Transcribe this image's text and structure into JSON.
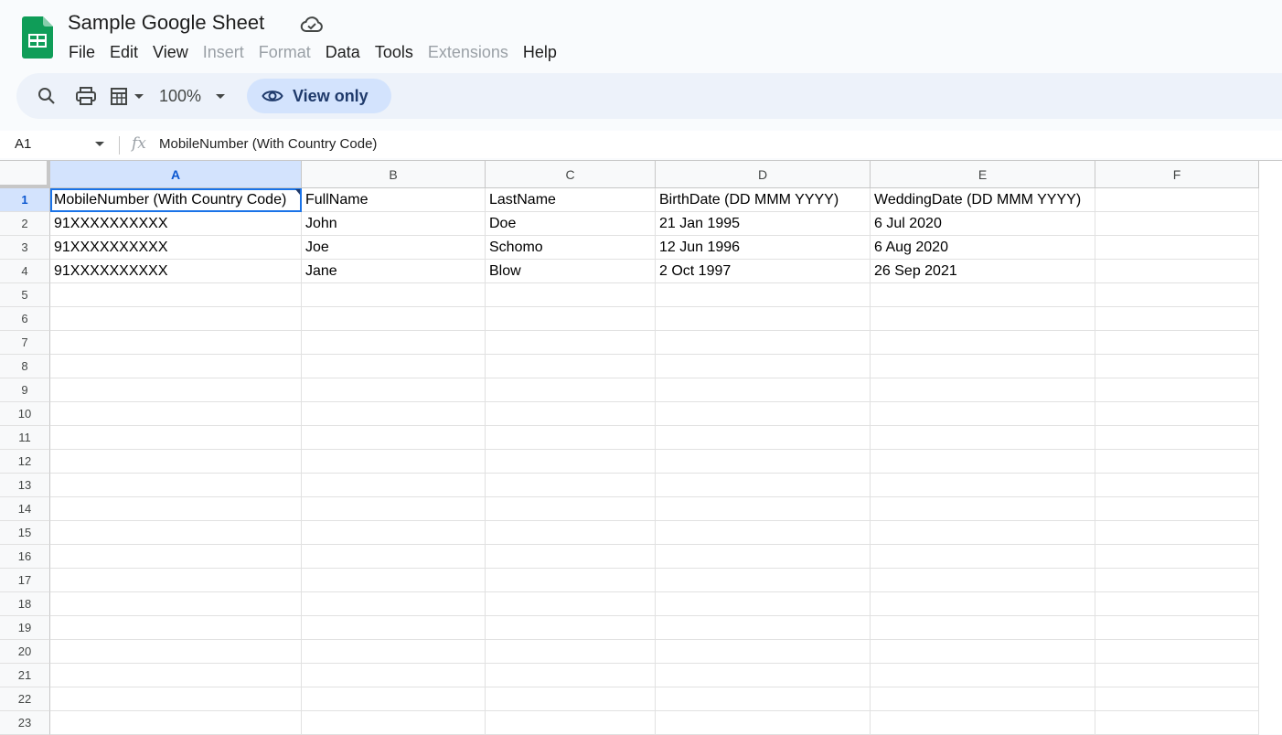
{
  "app": {
    "title": "Sample Google Sheet"
  },
  "menu": [
    {
      "label": "File",
      "disabled": false
    },
    {
      "label": "Edit",
      "disabled": false
    },
    {
      "label": "View",
      "disabled": false
    },
    {
      "label": "Insert",
      "disabled": true
    },
    {
      "label": "Format",
      "disabled": true
    },
    {
      "label": "Data",
      "disabled": false
    },
    {
      "label": "Tools",
      "disabled": false
    },
    {
      "label": "Extensions",
      "disabled": true
    },
    {
      "label": "Help",
      "disabled": false
    }
  ],
  "toolbar": {
    "zoom": "100%",
    "view_only_label": "View only",
    "icons": [
      "search-icon",
      "print-icon",
      "format-icon",
      "eye-icon"
    ]
  },
  "formula_bar": {
    "cell_ref": "A1",
    "fx_label": "fx",
    "value": "MobileNumber (With Country Code)"
  },
  "sheet": {
    "columns": [
      "A",
      "B",
      "C",
      "D",
      "E",
      "F"
    ],
    "active_column": "A",
    "active_row": "1",
    "rows": [
      {
        "num": "1",
        "cells": [
          "MobileNumber (With Country Code)",
          "FullName",
          "LastName",
          "BirthDate (DD MMM YYYY)",
          "WeddingDate (DD MMM YYYY)",
          ""
        ]
      },
      {
        "num": "2",
        "cells": [
          "91XXXXXXXXXX",
          "John",
          "Doe",
          "21 Jan 1995",
          "6 Jul 2020",
          ""
        ]
      },
      {
        "num": "3",
        "cells": [
          "91XXXXXXXXXX",
          "Joe",
          "Schomo",
          "12 Jun 1996",
          "6 Aug 2020",
          ""
        ]
      },
      {
        "num": "4",
        "cells": [
          "91XXXXXXXXXX",
          "Jane",
          "Blow",
          "2 Oct 1997",
          "26 Sep 2021",
          ""
        ]
      },
      {
        "num": "5",
        "cells": [
          "",
          "",
          "",
          "",
          "",
          ""
        ]
      },
      {
        "num": "6",
        "cells": [
          "",
          "",
          "",
          "",
          "",
          ""
        ]
      },
      {
        "num": "7",
        "cells": [
          "",
          "",
          "",
          "",
          "",
          ""
        ]
      },
      {
        "num": "8",
        "cells": [
          "",
          "",
          "",
          "",
          "",
          ""
        ]
      },
      {
        "num": "9",
        "cells": [
          "",
          "",
          "",
          "",
          "",
          ""
        ]
      },
      {
        "num": "10",
        "cells": [
          "",
          "",
          "",
          "",
          "",
          ""
        ]
      },
      {
        "num": "11",
        "cells": [
          "",
          "",
          "",
          "",
          "",
          ""
        ]
      },
      {
        "num": "12",
        "cells": [
          "",
          "",
          "",
          "",
          "",
          ""
        ]
      },
      {
        "num": "13",
        "cells": [
          "",
          "",
          "",
          "",
          "",
          ""
        ]
      },
      {
        "num": "14",
        "cells": [
          "",
          "",
          "",
          "",
          "",
          ""
        ]
      },
      {
        "num": "15",
        "cells": [
          "",
          "",
          "",
          "",
          "",
          ""
        ]
      },
      {
        "num": "16",
        "cells": [
          "",
          "",
          "",
          "",
          "",
          ""
        ]
      },
      {
        "num": "17",
        "cells": [
          "",
          "",
          "",
          "",
          "",
          ""
        ]
      },
      {
        "num": "18",
        "cells": [
          "",
          "",
          "",
          "",
          "",
          ""
        ]
      },
      {
        "num": "19",
        "cells": [
          "",
          "",
          "",
          "",
          "",
          ""
        ]
      },
      {
        "num": "20",
        "cells": [
          "",
          "",
          "",
          "",
          "",
          ""
        ]
      },
      {
        "num": "21",
        "cells": [
          "",
          "",
          "",
          "",
          "",
          ""
        ]
      },
      {
        "num": "22",
        "cells": [
          "",
          "",
          "",
          "",
          "",
          ""
        ]
      },
      {
        "num": "23",
        "cells": [
          "",
          "",
          "",
          "",
          "",
          ""
        ]
      }
    ]
  },
  "colors": {
    "brand_green": "#0f9d58",
    "accent_blue": "#0b57d0",
    "selection_blue": "#1a73e8",
    "header_highlight": "#d3e3fd"
  }
}
